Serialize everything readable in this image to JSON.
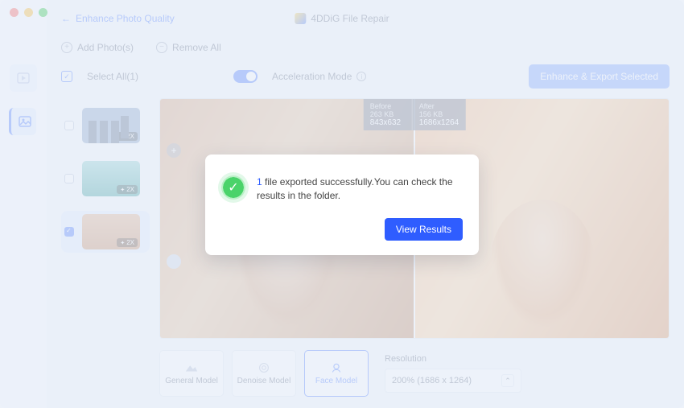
{
  "header": {
    "back_label": "Enhance Photo Quality",
    "app_title": "4DDiG File Repair"
  },
  "toolbar": {
    "add_photos": "Add Photo(s)",
    "remove_all": "Remove All",
    "select_all": "Select All(1)",
    "accel_mode": "Acceleration Mode",
    "export_label": "Enhance & Export Selected"
  },
  "thumbs": {
    "badge": "2X"
  },
  "preview": {
    "before_label": "Before",
    "before_size": "263 KB",
    "before_res": "843x632",
    "after_label": "After",
    "after_size": "156 KB",
    "after_res": "1686x1264"
  },
  "models": {
    "general": "General Model",
    "denoise": "Denoise Model",
    "face": "Face Model"
  },
  "resolution": {
    "label": "Resolution",
    "value": "200% (1686 x 1264)"
  },
  "modal": {
    "count": "1",
    "message_a": " file exported successfully.You can check the results in the folder.",
    "button": "View Results"
  }
}
